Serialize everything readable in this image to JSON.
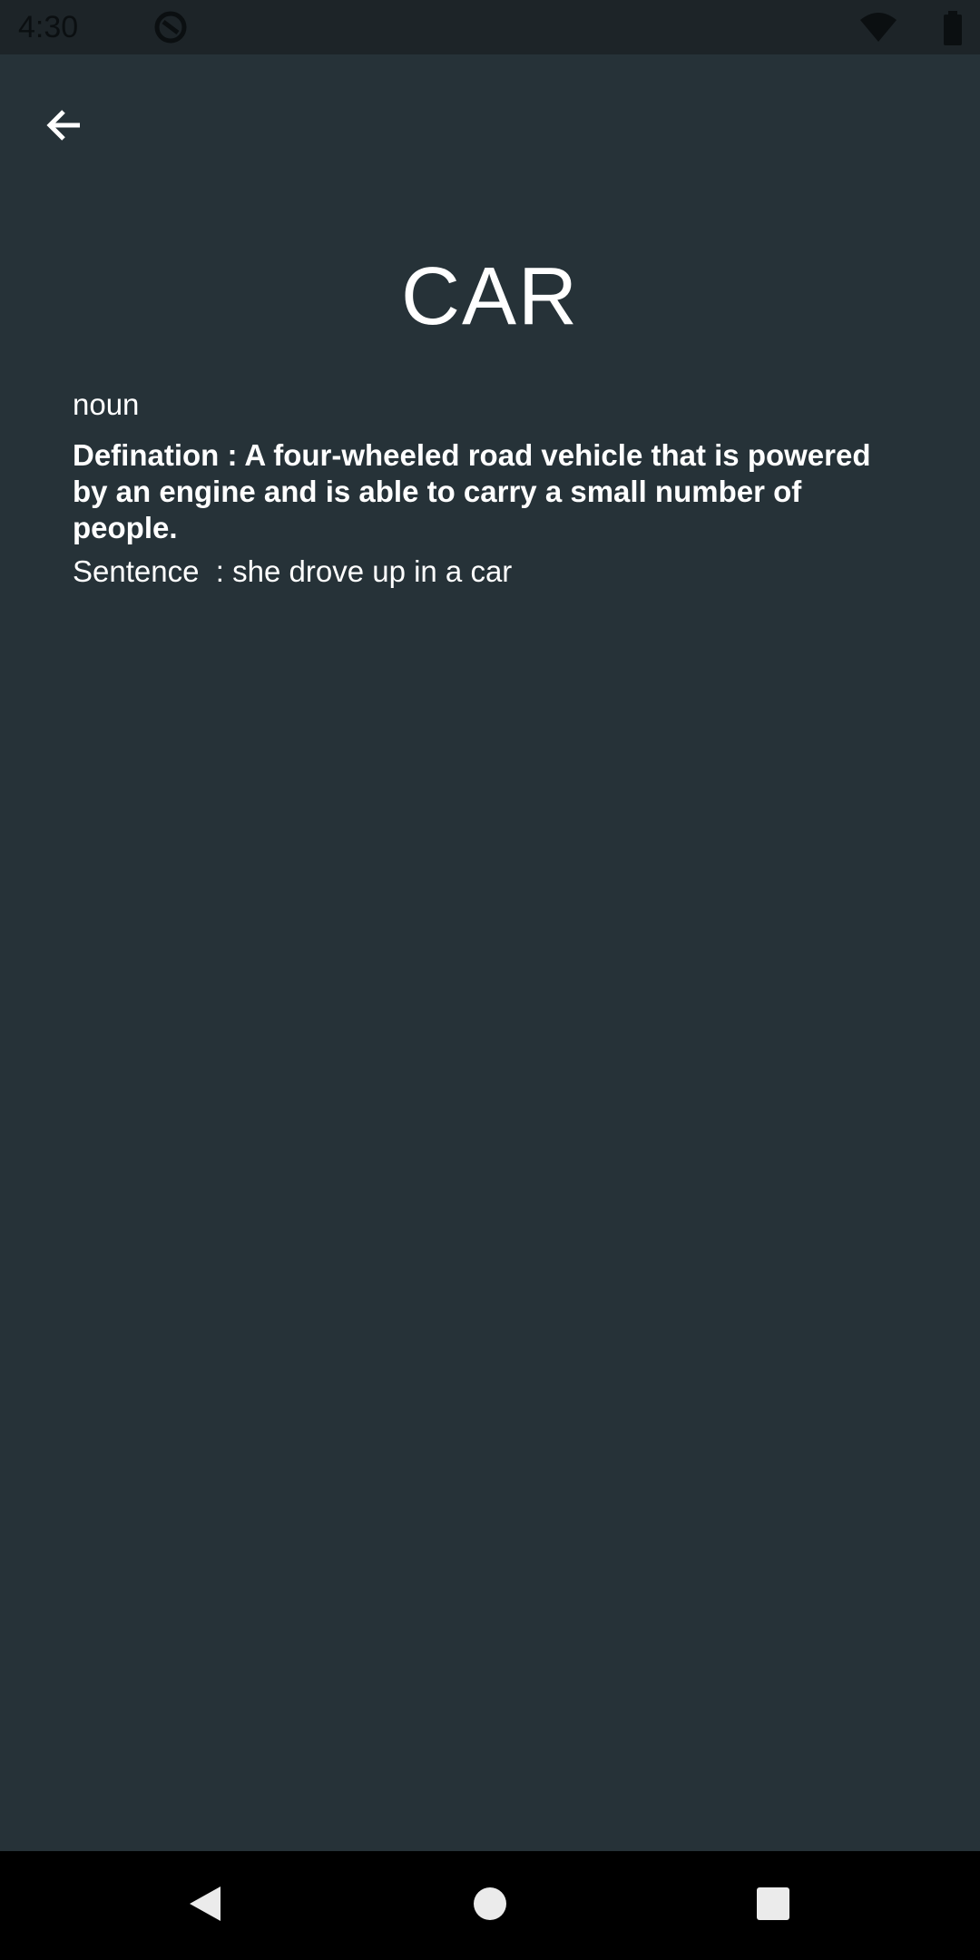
{
  "status_bar": {
    "time": "4:30",
    "icons": [
      "sync-icon",
      "wifi-icon",
      "battery-icon"
    ]
  },
  "app_bar": {
    "back_icon": "arrow-back-icon"
  },
  "word": {
    "title": "CAR",
    "part_of_speech": "noun",
    "definition": "Defination : A four-wheeled road vehicle that is powered by an engine and is able to carry a small number of people.",
    "sentence": "Sentence  : she drove up in a car"
  },
  "nav_bar": {
    "icons": [
      "nav-back-icon",
      "nav-home-icon",
      "nav-recents-icon"
    ]
  },
  "colors": {
    "background": "#263238",
    "status_bar": "#1d2428",
    "text": "#ffffff",
    "nav_bar": "#000000"
  }
}
